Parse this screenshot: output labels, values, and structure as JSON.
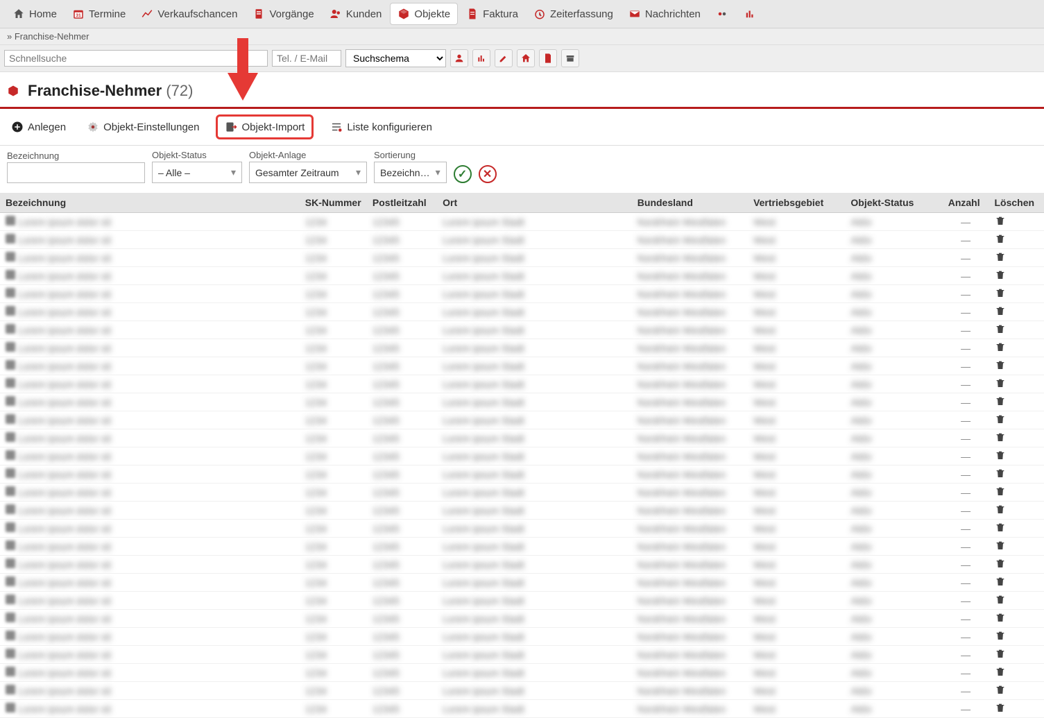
{
  "nav": {
    "items": [
      {
        "icon": "home",
        "label": "Home"
      },
      {
        "icon": "calendar",
        "label": "Termine"
      },
      {
        "icon": "chart-line",
        "label": "Verkaufschancen"
      },
      {
        "icon": "clipboard",
        "label": "Vorgänge"
      },
      {
        "icon": "users",
        "label": "Kunden"
      },
      {
        "icon": "package",
        "label": "Objekte",
        "active": true
      },
      {
        "icon": "document",
        "label": "Faktura"
      },
      {
        "icon": "clock",
        "label": "Zeiterfassung"
      },
      {
        "icon": "mail",
        "label": "Nachrichten"
      }
    ]
  },
  "breadcrumb": {
    "prefix": "» ",
    "current": "Franchise-Nehmer"
  },
  "search": {
    "quick_placeholder": "Schnellsuche",
    "tel_placeholder": "Tel. / E-Mail",
    "schema_label": "Suchschema"
  },
  "page": {
    "title": "Franchise-Nehmer",
    "count": "(72)"
  },
  "actions": {
    "create": "Anlegen",
    "settings": "Objekt-Einstellungen",
    "import": "Objekt-Import",
    "configure": "Liste konfigurieren"
  },
  "filters": {
    "bezeichnung_label": "Bezeichnung",
    "status_label": "Objekt-Status",
    "status_value": "– Alle –",
    "anlage_label": "Objekt-Anlage",
    "anlage_value": "Gesamter Zeitraum",
    "sort_label": "Sortierung",
    "sort_value": "Bezeichn…"
  },
  "table": {
    "headers": {
      "bezeichnung": "Bezeichnung",
      "sk": "SK-Nummer",
      "plz": "Postleitzahl",
      "ort": "Ort",
      "bundesland": "Bundesland",
      "vertrieb": "Vertriebsgebiet",
      "status": "Objekt-Status",
      "anzahl": "Anzahl",
      "loeschen": "Löschen"
    },
    "row_count": 28,
    "anzahl_value": "—"
  }
}
